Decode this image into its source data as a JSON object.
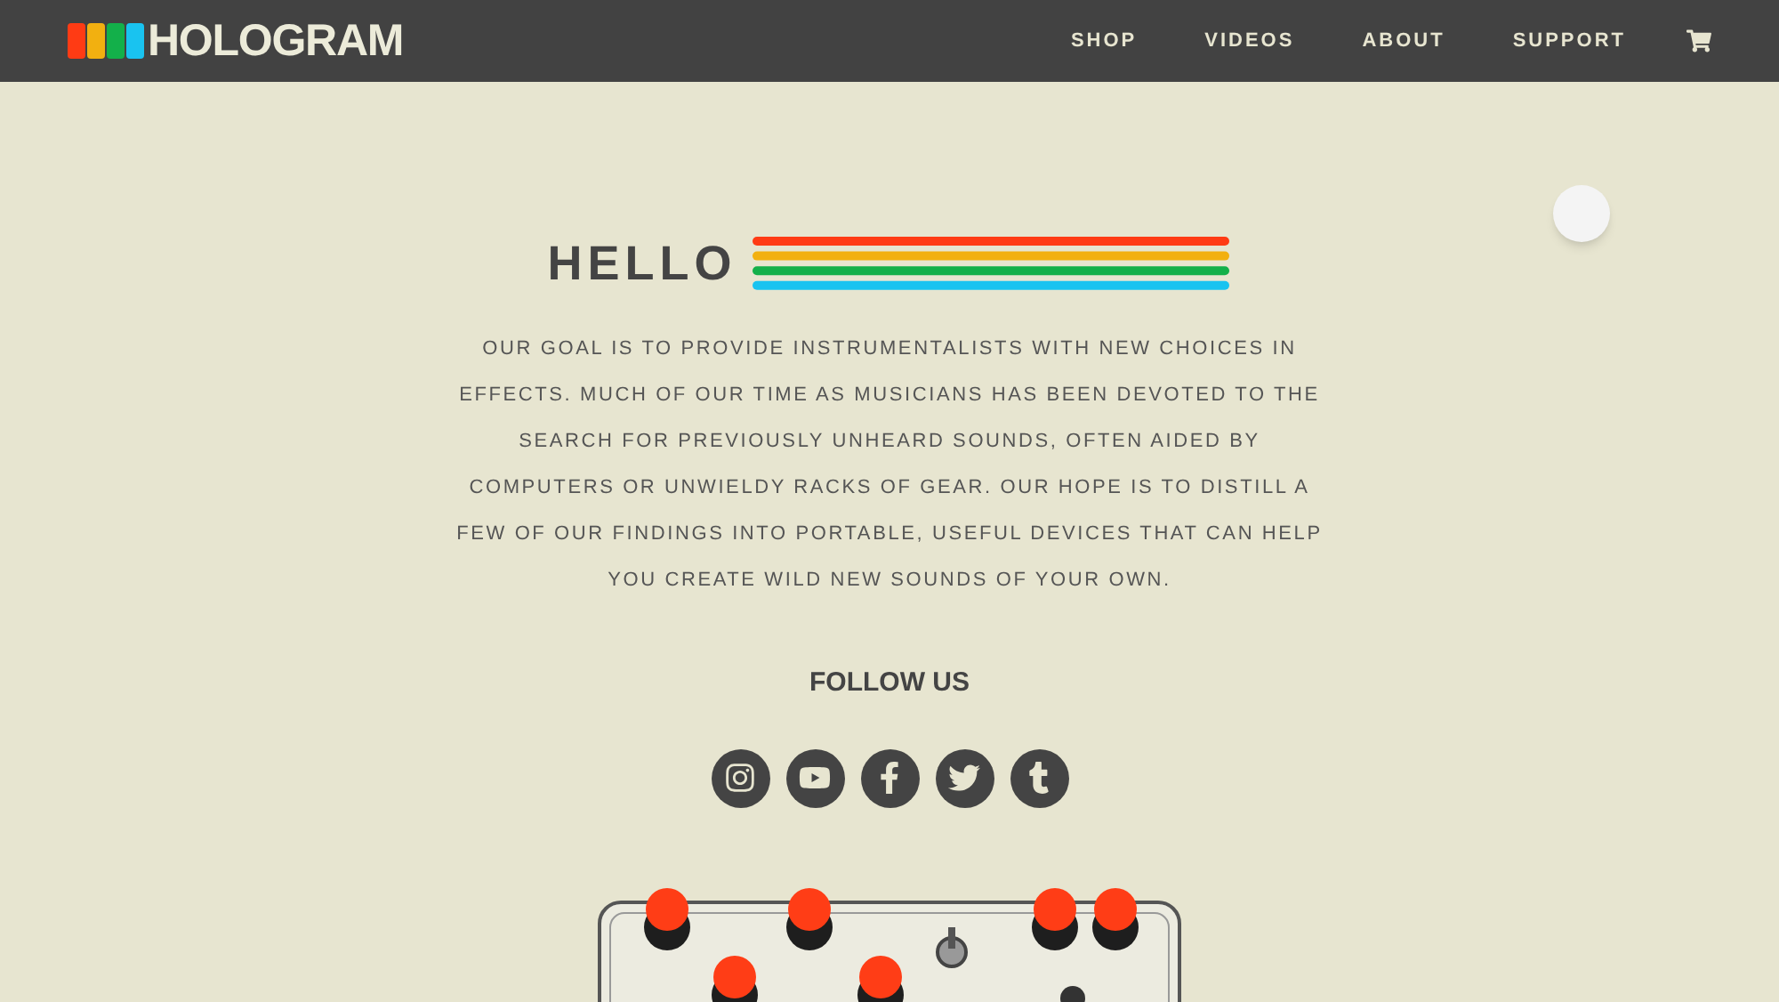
{
  "header": {
    "logo_text": "HOLOGRAM",
    "logo_stripes": [
      {
        "color": "#ff3b14"
      },
      {
        "color": "#f2b010"
      },
      {
        "color": "#13b04a"
      },
      {
        "color": "#19c3f0"
      }
    ],
    "nav": [
      {
        "label": "SHOP"
      },
      {
        "label": "VIDEOS"
      },
      {
        "label": "ABOUT"
      },
      {
        "label": "SUPPORT"
      }
    ]
  },
  "hero": {
    "title": "HELLO",
    "stripes": [
      {
        "color": "#ff3b14"
      },
      {
        "color": "#f2b010"
      },
      {
        "color": "#13b04a"
      },
      {
        "color": "#19c3f0"
      }
    ],
    "paragraph": "OUR GOAL IS TO PROVIDE INSTRUMENTALISTS WITH NEW CHOICES IN EFFECTS. MUCH OF OUR TIME AS MUSICIANS HAS BEEN DEVOTED TO THE SEARCH FOR PREVIOUSLY UNHEARD SOUNDS, OFTEN AIDED BY COMPUTERS OR UNWIELDY RACKS OF GEAR. OUR HOPE IS TO DISTILL A FEW OF OUR FINDINGS INTO PORTABLE, USEFUL DEVICES THAT CAN HELP YOU CREATE WILD NEW SOUNDS OF YOUR OWN."
  },
  "follow": {
    "title": "FOLLOW US",
    "links": [
      {
        "kind": "instagram"
      },
      {
        "kind": "youtube"
      },
      {
        "kind": "facebook"
      },
      {
        "kind": "twitter"
      },
      {
        "kind": "tumblr"
      }
    ]
  }
}
